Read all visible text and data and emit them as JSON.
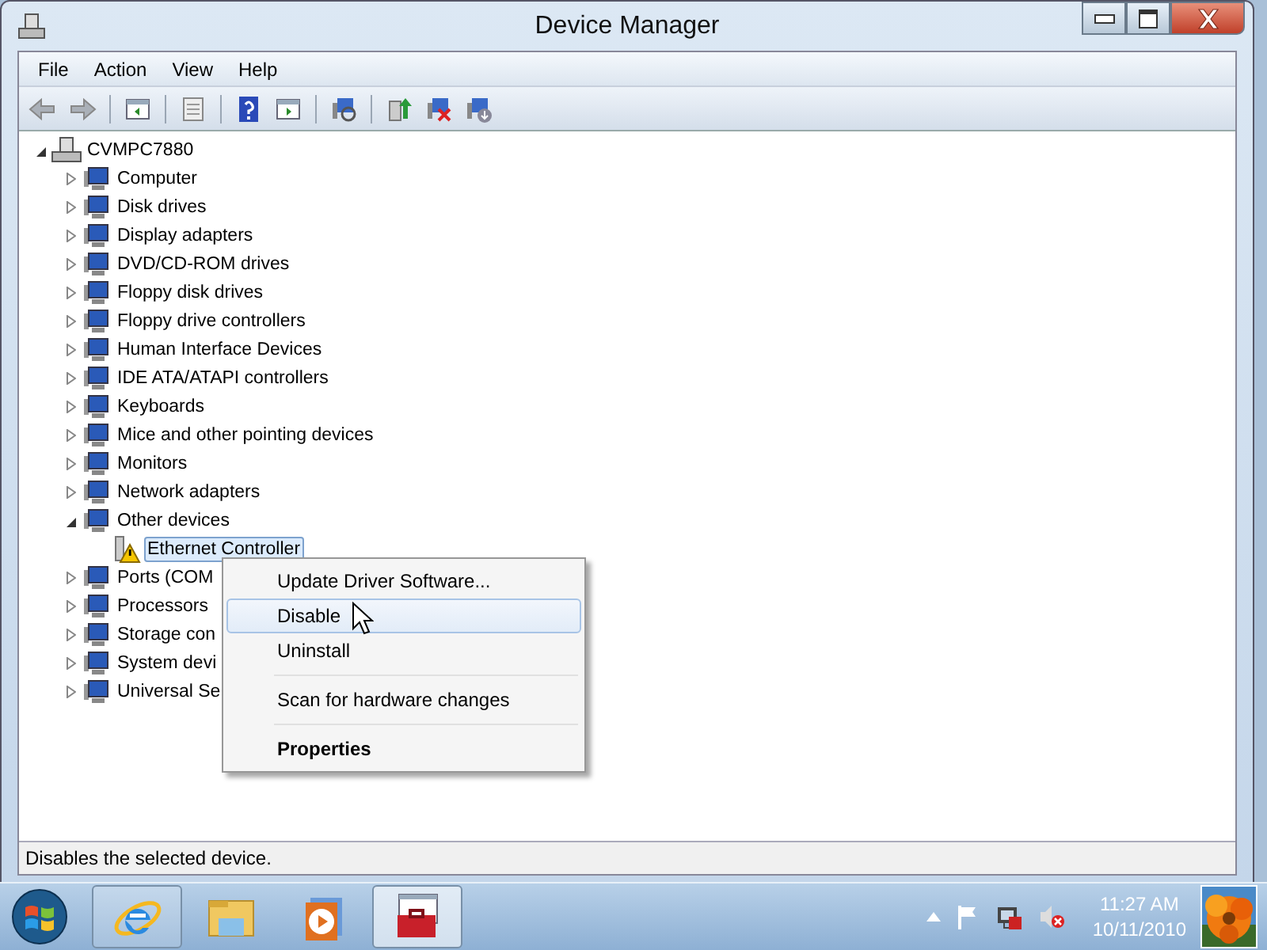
{
  "window": {
    "title": "Device Manager"
  },
  "menu_bar": [
    "File",
    "Action",
    "View",
    "Help"
  ],
  "tree": {
    "label": "CVMPC7880",
    "expanded": true,
    "selected": false,
    "children": [
      {
        "label": "Computer",
        "expanded": false,
        "selected": false
      },
      {
        "label": "Disk drives",
        "expanded": false,
        "selected": false
      },
      {
        "label": "Display adapters",
        "expanded": false,
        "selected": false
      },
      {
        "label": "DVD/CD-ROM drives",
        "expanded": false,
        "selected": false
      },
      {
        "label": "Floppy disk drives",
        "expanded": false,
        "selected": false
      },
      {
        "label": "Floppy drive controllers",
        "expanded": false,
        "selected": false
      },
      {
        "label": "Human Interface Devices",
        "expanded": false,
        "selected": false
      },
      {
        "label": "IDE ATA/ATAPI controllers",
        "expanded": false,
        "selected": false
      },
      {
        "label": "Keyboards",
        "expanded": false,
        "selected": false
      },
      {
        "label": "Mice and other pointing devices",
        "expanded": false,
        "selected": false
      },
      {
        "label": "Monitors",
        "expanded": false,
        "selected": false
      },
      {
        "label": "Network adapters",
        "expanded": false,
        "selected": false
      },
      {
        "label": "Other devices",
        "expanded": true,
        "selected": false,
        "children": [
          {
            "label": "Ethernet Controller",
            "selected": true,
            "warning": true
          }
        ]
      },
      {
        "label": "Ports (COM",
        "expanded": false,
        "selected": false
      },
      {
        "label": "Processors",
        "expanded": false,
        "selected": false
      },
      {
        "label": "Storage con",
        "expanded": false,
        "selected": false
      },
      {
        "label": "System devi",
        "expanded": false,
        "selected": false
      },
      {
        "label": "Universal Se",
        "expanded": false,
        "selected": false
      }
    ]
  },
  "context_menu": [
    {
      "label": "Update Driver Software...",
      "selected": false,
      "default": false,
      "separator_before": false
    },
    {
      "label": "Disable",
      "selected": true,
      "default": false,
      "separator_before": false
    },
    {
      "label": "Uninstall",
      "selected": false,
      "default": false,
      "separator_before": false
    },
    {
      "label": "Scan for hardware changes",
      "selected": false,
      "default": false,
      "separator_before": true
    },
    {
      "label": "Properties",
      "selected": false,
      "default": true,
      "separator_before": true
    }
  ],
  "status_bar": "Disables the selected device.",
  "taskbar": {
    "buttons": [
      {
        "running": true,
        "selected": false
      },
      {
        "running": false,
        "selected": false
      },
      {
        "running": false,
        "selected": false
      },
      {
        "running": true,
        "selected": true
      }
    ],
    "time": "11:27 AM",
    "date": "10/11/2010"
  }
}
